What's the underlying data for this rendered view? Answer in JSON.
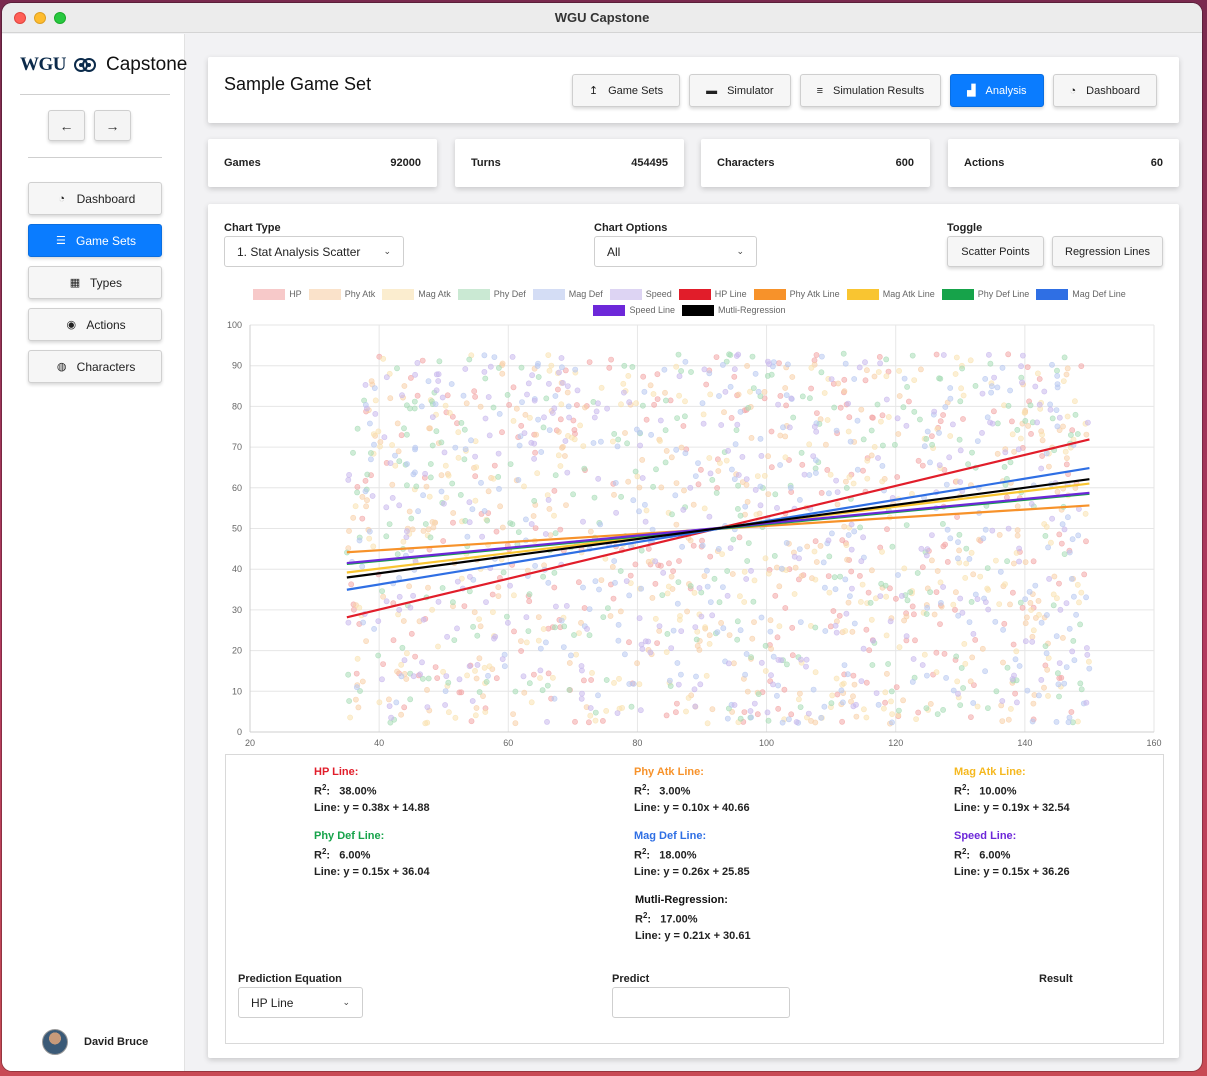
{
  "window": {
    "title": "WGU Capstone"
  },
  "brand": {
    "logo": "WGU",
    "name": "Capstone"
  },
  "nav_arrows": {
    "back": "←",
    "forward": "→"
  },
  "sidebar": {
    "items": [
      {
        "label": "Dashboard",
        "icon": "gauge-icon",
        "glyph": "◔",
        "active": false
      },
      {
        "label": "Game Sets",
        "icon": "sliders-icon",
        "glyph": "☰",
        "active": true
      },
      {
        "label": "Types",
        "icon": "table-icon",
        "glyph": "▦",
        "active": false
      },
      {
        "label": "Actions",
        "icon": "eye-icon",
        "glyph": "◉",
        "active": false
      },
      {
        "label": "Characters",
        "icon": "user-circle-icon",
        "glyph": "◍",
        "active": false
      }
    ]
  },
  "user": {
    "name": "David Bruce"
  },
  "header": {
    "title": "Sample Game Set",
    "buttons": [
      {
        "label": "Game Sets",
        "icon": "upload-arrow-icon",
        "glyph": "↥",
        "active": false
      },
      {
        "label": "Simulator",
        "icon": "monitor-icon",
        "glyph": "▬",
        "active": false
      },
      {
        "label": "Simulation Results",
        "icon": "list-icon",
        "glyph": "≡",
        "active": false
      },
      {
        "label": "Analysis",
        "icon": "bar-chart-icon",
        "glyph": "▟",
        "active": true
      },
      {
        "label": "Dashboard",
        "icon": "gauge-icon",
        "glyph": "◔",
        "active": false
      }
    ]
  },
  "stats": [
    {
      "label": "Games",
      "value": "92000"
    },
    {
      "label": "Turns",
      "value": "454495"
    },
    {
      "label": "Characters",
      "value": "600"
    },
    {
      "label": "Actions",
      "value": "60"
    }
  ],
  "controls": {
    "chart_type_label": "Chart Type",
    "chart_type_value": "1. Stat Analysis Scatter",
    "chart_options_label": "Chart Options",
    "chart_options_value": "All",
    "toggle_label": "Toggle",
    "scatter_button": "Scatter Points",
    "regression_button": "Regression Lines"
  },
  "chart_data": {
    "type": "scatter",
    "xlim": [
      20,
      160
    ],
    "ylim": [
      0,
      100
    ],
    "x_ticks": [
      20,
      40,
      60,
      80,
      100,
      120,
      140,
      160
    ],
    "y_ticks": [
      0,
      10,
      20,
      30,
      40,
      50,
      60,
      70,
      80,
      90,
      100
    ],
    "grid": true,
    "legend_position": "top",
    "scatter_series": [
      {
        "name": "HP",
        "color": "#f3a6a6"
      },
      {
        "name": "Phy Atk",
        "color": "#f8cfa8"
      },
      {
        "name": "Mag Atk",
        "color": "#f9e2b0"
      },
      {
        "name": "Phy Def",
        "color": "#a8dcb7"
      },
      {
        "name": "Mag Def",
        "color": "#b8c8f0"
      },
      {
        "name": "Speed",
        "color": "#c8b8ec"
      }
    ],
    "scatter_x_range": [
      35,
      150
    ],
    "lines": [
      {
        "name": "HP Line",
        "color": "#e11d2a",
        "slope": 0.38,
        "intercept": 14.88,
        "x_range": [
          35,
          150
        ]
      },
      {
        "name": "Phy Atk Line",
        "color": "#f7922a",
        "slope": 0.1,
        "intercept": 40.66,
        "x_range": [
          35,
          150
        ]
      },
      {
        "name": "Mag Atk Line",
        "color": "#f9c531",
        "slope": 0.19,
        "intercept": 32.54,
        "x_range": [
          35,
          150
        ]
      },
      {
        "name": "Phy Def Line",
        "color": "#16a34a",
        "slope": 0.15,
        "intercept": 36.04,
        "x_range": [
          35,
          150
        ]
      },
      {
        "name": "Mag Def Line",
        "color": "#2f6fe4",
        "slope": 0.26,
        "intercept": 25.85,
        "x_range": [
          35,
          150
        ]
      },
      {
        "name": "Speed Line",
        "color": "#6d28d9",
        "slope": 0.15,
        "intercept": 36.26,
        "x_range": [
          35,
          150
        ]
      },
      {
        "name": "Mutli-Regression",
        "color": "#000000",
        "slope": 0.21,
        "intercept": 30.61,
        "x_range": [
          35,
          150
        ]
      }
    ]
  },
  "regressions": [
    {
      "name": "HP Line:",
      "color": "#e11d2a",
      "r2_label": "R",
      "r2_sup": "2",
      "r2_value": "38.00%",
      "line": "Line: y = 0.38x + 14.88"
    },
    {
      "name": "Phy Atk Line:",
      "color": "#f7922a",
      "r2_label": "R",
      "r2_sup": "2",
      "r2_value": "3.00%",
      "line": "Line: y = 0.10x + 40.66"
    },
    {
      "name": "Mag Atk Line:",
      "color": "#f5b81f",
      "r2_label": "R",
      "r2_sup": "2",
      "r2_value": "10.00%",
      "line": "Line: y = 0.19x + 32.54"
    },
    {
      "name": "Phy Def Line:",
      "color": "#16a34a",
      "r2_label": "R",
      "r2_sup": "2",
      "r2_value": "6.00%",
      "line": "Line: y = 0.15x + 36.04"
    },
    {
      "name": "Mag Def Line:",
      "color": "#2f6fe4",
      "r2_label": "R",
      "r2_sup": "2",
      "r2_value": "18.00%",
      "line": "Line: y = 0.26x + 25.85"
    },
    {
      "name": "Speed Line:",
      "color": "#6d28d9",
      "r2_label": "R",
      "r2_sup": "2",
      "r2_value": "6.00%",
      "line": "Line: y = 0.15x + 36.26"
    },
    {
      "name": "Mutli-Regression:",
      "color": "#111111",
      "r2_label": "R",
      "r2_sup": "2",
      "r2_value": "17.00%",
      "line": "Line: y = 0.21x + 30.61"
    }
  ],
  "prediction": {
    "equation_label": "Prediction Equation",
    "equation_value": "HP Line",
    "predict_label": "Predict",
    "predict_value": "",
    "result_label": "Result"
  }
}
